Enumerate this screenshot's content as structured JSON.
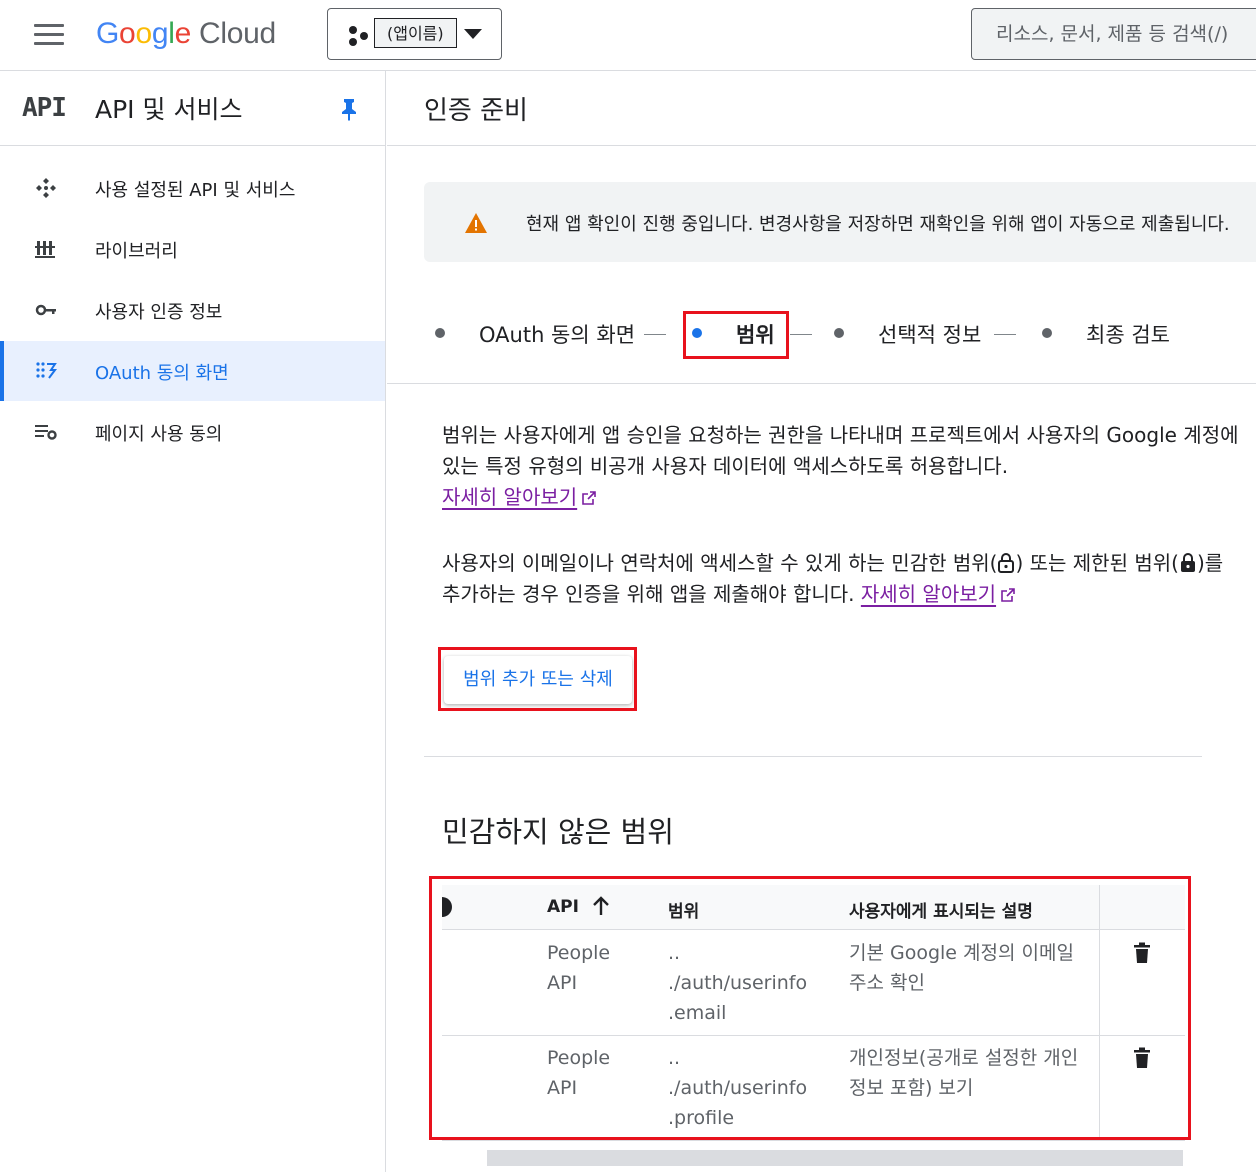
{
  "header": {
    "logo_letters": [
      "G",
      "o",
      "o",
      "g",
      "l",
      "e"
    ],
    "logo_cloud": "Cloud",
    "project_name": "(앱이름)",
    "search_placeholder": "리소스, 문서, 제품 등 검색(/)"
  },
  "sidebar": {
    "glyph": "API",
    "title": "API 및 서비스",
    "items": [
      {
        "label": "사용 설정된 API 및 서비스",
        "icon": "api-diamond-icon"
      },
      {
        "label": "라이브러리",
        "icon": "library-icon"
      },
      {
        "label": "사용자 인증 정보",
        "icon": "key-icon"
      },
      {
        "label": "OAuth 동의 화면",
        "icon": "oauth-dots-icon",
        "active": true
      },
      {
        "label": "페이지 사용 동의",
        "icon": "settings-list-icon"
      }
    ]
  },
  "main": {
    "title": "인증 준비",
    "banner_text": "현재 앱 확인이 진행 중입니다. 변경사항을 저장하면 재확인을 위해 앱이 자동으로 제출됩니다.",
    "steps": [
      "OAuth 동의 화면",
      "범위",
      "선택적 정보",
      "최종 검토"
    ],
    "active_step": 1,
    "para1_text": "범위는 사용자에게 앱 승인을 요청하는 권한을 나타내며 프로젝트에서 사용자의 Google 계정에 있는 특정 유형의 비공개 사용자 데이터에 액세스하도록 허용합니다.",
    "para1_link": "자세히 알아보기",
    "para2_a": "사용자의 이메일이나 연락처에 액세스할 수 있게 하는 민감한 범위(",
    "para2_b": ") 또는 제한된 범위(",
    "para2_c": ")를 추가하는 경우 인증을 위해 앱을 제출해야 합니다.",
    "para2_link": "자세히 알아보기",
    "add_button": "범위 추가 또는 삭제",
    "section_title": "민감하지 않은 범위",
    "table": {
      "headers": [
        "API",
        "범위",
        "사용자에게 표시되는 설명"
      ],
      "rows": [
        {
          "api": [
            "People",
            "API"
          ],
          "scope": [
            "..",
            "./auth/userinfo",
            ".email"
          ],
          "desc": [
            "기본 Google 계정의 이메일",
            "주소 확인"
          ]
        },
        {
          "api": [
            "People",
            "API"
          ],
          "scope": [
            "..",
            "./auth/userinfo",
            ".profile"
          ],
          "desc": [
            "개인정보(공개로 설정한 개인",
            "정보 포함) 보기"
          ]
        }
      ]
    }
  },
  "colors": {
    "accent": "#1a73e8",
    "highlight": "#e8121d",
    "warning": "#e37400",
    "link": "#7b1fa2"
  }
}
